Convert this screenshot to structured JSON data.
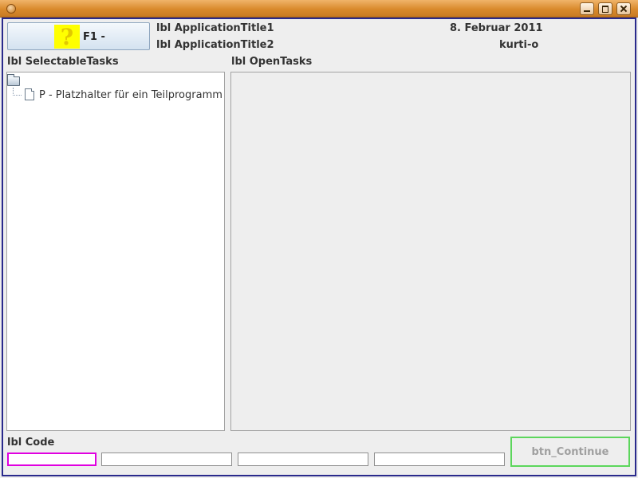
{
  "window": {
    "controls": [
      "minimize-icon",
      "maximize-icon",
      "close-icon"
    ]
  },
  "header": {
    "help_button": {
      "icon_glyph": "?",
      "label": "F1 -"
    },
    "app_title_1": "lbl ApplicationTitle1",
    "app_title_2": "lbl ApplicationTitle2",
    "date": "8. Februar 2011",
    "user": "kurti-o"
  },
  "selectable_tasks": {
    "label": "lbl SelectableTasks",
    "tree": {
      "root_icon": "folder-icon",
      "items": [
        {
          "icon": "document-icon",
          "label": "P - Platzhalter für ein Teilprogramm"
        }
      ]
    }
  },
  "open_tasks": {
    "label": "lbl OpenTasks"
  },
  "code": {
    "label": "lbl Code",
    "fields": [
      {
        "value": "",
        "focused": true
      },
      {
        "value": ""
      },
      {
        "value": ""
      },
      {
        "value": ""
      }
    ]
  },
  "continue_button": {
    "label": "btn_Continue"
  },
  "colors": {
    "titlebar": "#d98a2c",
    "frame_border": "#2a2a8c",
    "help_icon_bg": "#ffff00",
    "focused_field_border": "#e000e0",
    "continue_border": "#5cd65c"
  }
}
